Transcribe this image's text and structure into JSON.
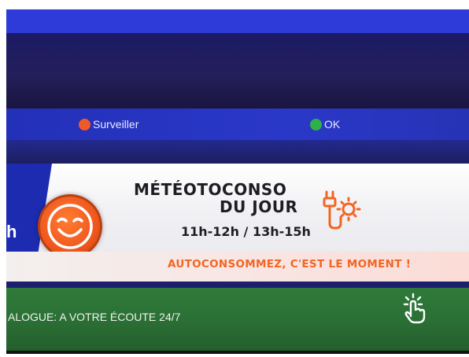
{
  "legend": {
    "items": [
      {
        "label": "Surveiller",
        "color": "#f05a28"
      },
      {
        "label": "OK",
        "color": "#2fb14a"
      }
    ]
  },
  "banner": {
    "side_letter": "h",
    "title_line1": "MÉTÉOTOCONSO",
    "title_line2": "DU JOUR",
    "hours": "11h-12h  /  13h-15h",
    "tagline": "AUTOCONSOMMEZ, C'EST LE MOMENT !",
    "accent_color": "#f26522",
    "smiley_icon": "happy-face-icon",
    "plug_icon": "plug-sun-icon"
  },
  "bottom_bar": {
    "text": "ALOGUE: A VOTRE ÉCOUTE 24/7",
    "icon": "tap-hand-icon"
  }
}
